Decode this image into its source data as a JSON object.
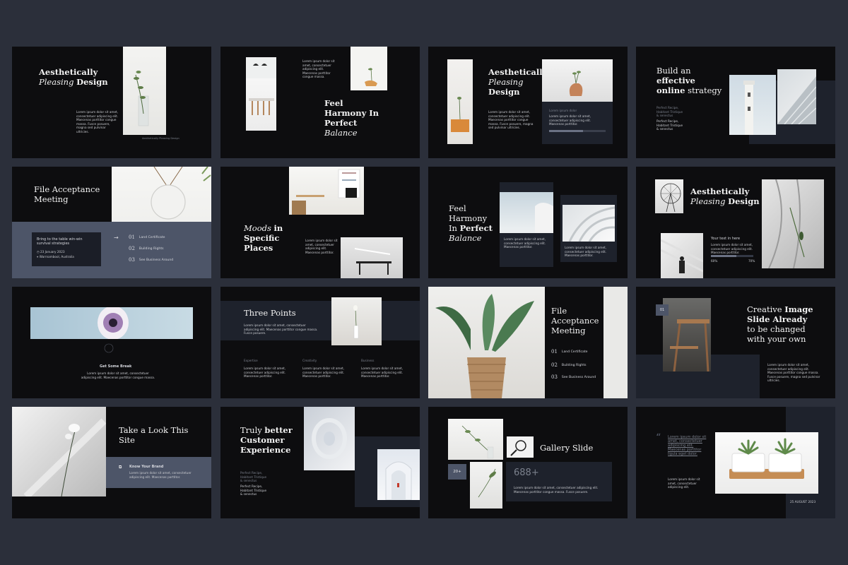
{
  "colors": {
    "background": "#2b2f3a",
    "slide": "#0d0d0f",
    "panel": "#1e222c",
    "slate": "#4d5568"
  },
  "lorem": {
    "s1": "Lorem ipsum dolor sit amet, consectetuer adipiscing elit. Maecenas porttitor congue massa. Fusce posuere, magna sed pulvinar ultricies.",
    "s2": "Lorem ipsum dolor sit amet, consectetuer adipiscing elit. Maecenas porttitor congue massa.",
    "s3": "Lorem ipsum dolor sit amet, consectetuer adipiscing elit. Maecenas porttitor.",
    "s4": "Lorem ipsum dolor sit amet, consectetuer adipiscing elit. Maecenas porttitor congue massa. Fusce posuere.",
    "short": "Lorem ipsum dolor sit amet, consectetuer adipiscing elit.",
    "long": "Lorem ipsum dolor sit amet, consectetuer adipiscing elit. Maecenas porttitor congue massa. Fusce posuere, magna sed pulvinar ultricies, purus lectus malesuada libero, sit amet commodo magna eros quis urna."
  },
  "slides": [
    {
      "id": 1,
      "title_a": "Aesthetically",
      "title_b": "Pleasing",
      "title_c": "Design",
      "caption": "Aesthetically Pleasing Design"
    },
    {
      "id": 2,
      "title_a": "Feel",
      "title_b": "Harmony In",
      "title_c": "Perfect",
      "title_d": "Balance"
    },
    {
      "id": 3,
      "title_a": "Aesthetically",
      "title_b": "Pleasing",
      "title_c": "Design",
      "sub": "Lorem ipsum dolor"
    },
    {
      "id": 4,
      "title_a": "Build an",
      "title_b": "effective",
      "title_c": "online",
      "title_d": "strategy",
      "small": "Perfect Recipe, Habitant Tristique & senectus"
    },
    {
      "id": 5,
      "title_a": "File Acceptance",
      "title_b": "Meeting",
      "box_title": "Bring to the table win-win survival strategies",
      "date": "23 January 2023",
      "place": "Warrnambool, Australia",
      "items": [
        {
          "n": "01",
          "t": "Land Certificate"
        },
        {
          "n": "02",
          "t": "Building Rights"
        },
        {
          "n": "03",
          "t": "See Business Around"
        }
      ]
    },
    {
      "id": 6,
      "title_a": "Moods",
      "title_b": "in",
      "title_c": "Specific",
      "title_d": "Places"
    },
    {
      "id": 7,
      "title_a": "Feel",
      "title_b": "Harmony",
      "title_c": "In",
      "title_d": "Perfect",
      "title_e": "Balance"
    },
    {
      "id": 8,
      "title_a": "Aesthetically",
      "title_b": "Pleasing",
      "title_c": "Design",
      "sub": "Your text in here",
      "p1": "60%",
      "p2": "70%"
    },
    {
      "id": 9,
      "sub": "Get Some Break"
    },
    {
      "id": 10,
      "title": "Three Points",
      "cols": [
        "Expertise",
        "Creativity",
        "Business"
      ]
    },
    {
      "id": 11,
      "title_a": "File",
      "title_b": "Acceptance",
      "title_c": "Meeting",
      "items": [
        {
          "n": "01",
          "t": "Land Certificate"
        },
        {
          "n": "02",
          "t": "Building Rights"
        },
        {
          "n": "03",
          "t": "See Business Around"
        }
      ]
    },
    {
      "id": 12,
      "badge": "01",
      "title_a": "Creative",
      "title_b": "Image",
      "title_c": "Slide Already",
      "title_d": "to be changed",
      "title_e": "with your own"
    },
    {
      "id": 13,
      "title_a": "Take a Look This",
      "title_b": "Site",
      "sub": "Know Your Brand"
    },
    {
      "id": 14,
      "title_a": "Truly",
      "title_b": "better",
      "title_c": "Customer",
      "title_d": "Experience",
      "small": "Perfect Recipe, Habitant Tristique & senectus"
    },
    {
      "id": 15,
      "title": "Gallery Slide",
      "badge": "20+",
      "big": "688+"
    },
    {
      "id": 16,
      "quote": "Lorem ipsum dolor sit amet, consectetuer adipiscing elit. Maecenas porttitor ligula eget dolor.",
      "date": "25 AUGUST 2023"
    }
  ]
}
